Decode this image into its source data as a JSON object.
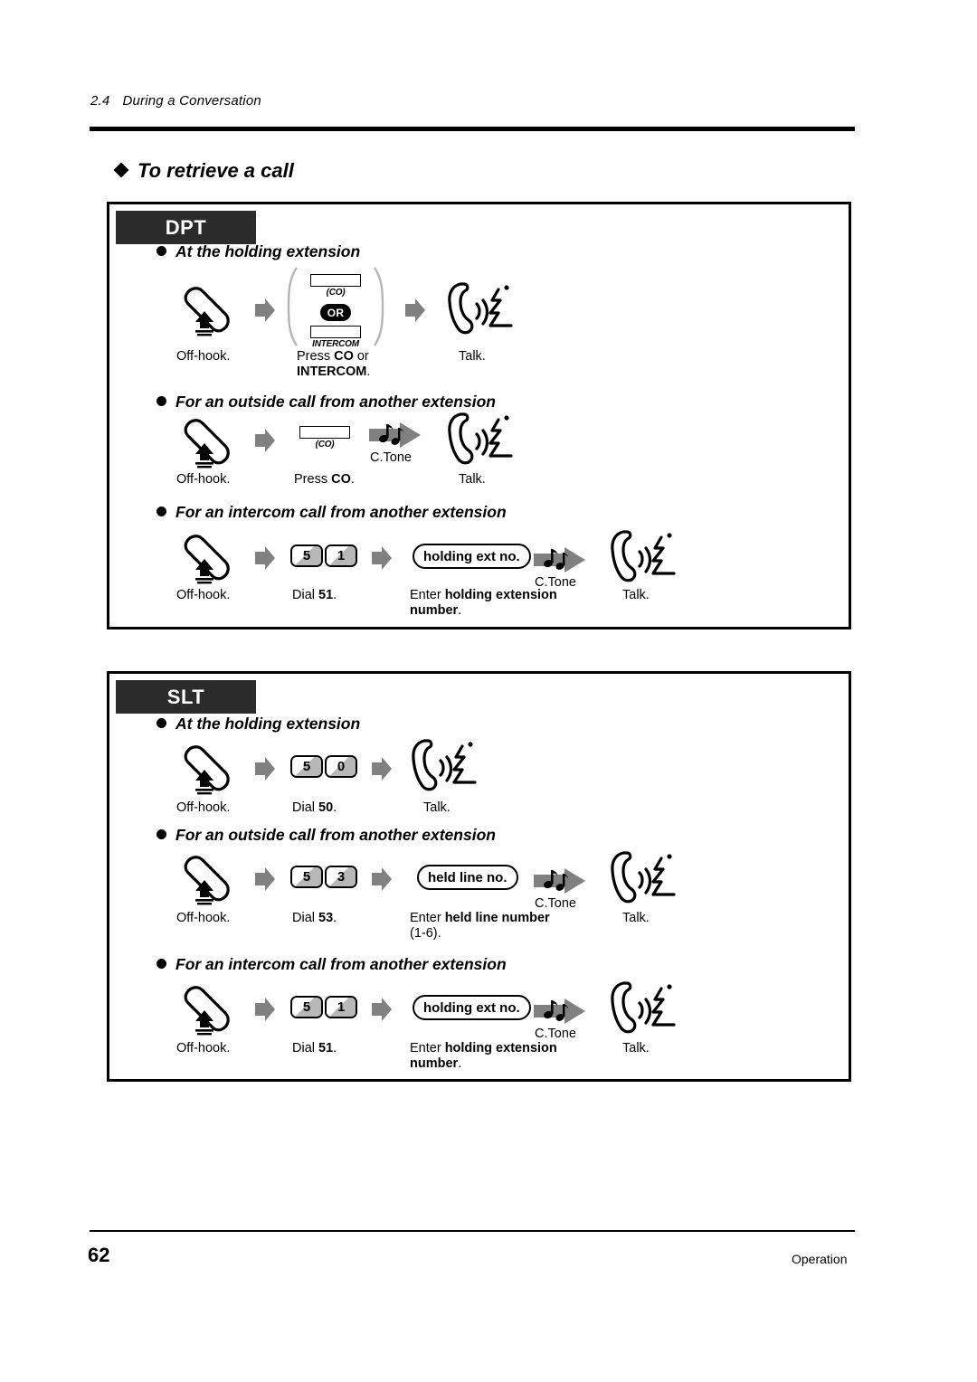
{
  "running_head": {
    "number": "2.4",
    "title": "During a Conversation"
  },
  "section_title": "To retrieve a call",
  "panels": [
    {
      "tab": "DPT",
      "groups": [
        {
          "heading": "At the holding extension",
          "steps": [
            {
              "icon": "off-hook-handset-icon",
              "caption": "Off-hook."
            },
            {
              "icon": "co-intercom-choice-icon",
              "co_label": "(CO)",
              "or_label": "OR",
              "intercom_label": "INTERCOM",
              "caption_line1": "Press ",
              "caption_bold1": "CO",
              "caption_mid": " or",
              "caption_bold2": "INTERCOM",
              "caption_end": "."
            },
            {
              "icon": "talk-handset-icon",
              "caption": "Talk."
            }
          ]
        },
        {
          "heading": "For an outside call from another extension",
          "steps": [
            {
              "icon": "off-hook-handset-icon",
              "caption": "Off-hook."
            },
            {
              "icon": "co-button-icon",
              "co_label": "(CO)",
              "caption_pre": "Press ",
              "caption_bold": "CO",
              "caption_post": "."
            },
            {
              "icon": "confirmation-tone-icon",
              "tone_label": "C.Tone"
            },
            {
              "icon": "talk-handset-icon",
              "caption": "Talk."
            }
          ]
        },
        {
          "heading": "For an intercom call from another extension",
          "steps": [
            {
              "icon": "off-hook-handset-icon",
              "caption": "Off-hook."
            },
            {
              "icon": "dial-keys-icon",
              "keys": [
                "5",
                "1"
              ],
              "caption_pre": "Dial ",
              "caption_bold": "51",
              "caption_post": "."
            },
            {
              "icon": "entry-pill-icon",
              "pill": "holding ext no.",
              "caption_pre": "Enter ",
              "caption_bold": "holding extension number",
              "caption_post": "."
            },
            {
              "icon": "confirmation-tone-icon",
              "tone_label": "C.Tone"
            },
            {
              "icon": "talk-handset-icon",
              "caption": "Talk."
            }
          ]
        }
      ]
    },
    {
      "tab": "SLT",
      "groups": [
        {
          "heading": "At the holding extension",
          "steps": [
            {
              "icon": "off-hook-handset-icon",
              "caption": "Off-hook."
            },
            {
              "icon": "dial-keys-icon",
              "keys": [
                "5",
                "0"
              ],
              "caption_pre": "Dial ",
              "caption_bold": "50",
              "caption_post": "."
            },
            {
              "icon": "talk-handset-icon",
              "caption": "Talk."
            }
          ]
        },
        {
          "heading": "For an outside call from another extension",
          "steps": [
            {
              "icon": "off-hook-handset-icon",
              "caption": "Off-hook."
            },
            {
              "icon": "dial-keys-icon",
              "keys": [
                "5",
                "3"
              ],
              "caption_pre": "Dial ",
              "caption_bold": "53",
              "caption_post": "."
            },
            {
              "icon": "entry-pill-icon",
              "pill": "held line no.",
              "caption_pre": "Enter ",
              "caption_bold": "held line number",
              "caption_post": " (1-6)."
            },
            {
              "icon": "confirmation-tone-icon",
              "tone_label": "C.Tone"
            },
            {
              "icon": "talk-handset-icon",
              "caption": "Talk."
            }
          ]
        },
        {
          "heading": "For an intercom call from another extension",
          "steps": [
            {
              "icon": "off-hook-handset-icon",
              "caption": "Off-hook."
            },
            {
              "icon": "dial-keys-icon",
              "keys": [
                "5",
                "1"
              ],
              "caption_pre": "Dial ",
              "caption_bold": "51",
              "caption_post": "."
            },
            {
              "icon": "entry-pill-icon",
              "pill": "holding ext no.",
              "caption_pre": "Enter ",
              "caption_bold": "holding extension number",
              "caption_post": "."
            },
            {
              "icon": "confirmation-tone-icon",
              "tone_label": "C.Tone"
            },
            {
              "icon": "talk-handset-icon",
              "caption": "Talk."
            }
          ]
        }
      ]
    }
  ],
  "footer": {
    "page_number": "62",
    "right_label": "Operation"
  },
  "colors": {
    "ink": "#000000",
    "tab_bg": "#2b2b2b",
    "arrow_gray": "#808080",
    "key_shade": "#b8b8b8"
  }
}
